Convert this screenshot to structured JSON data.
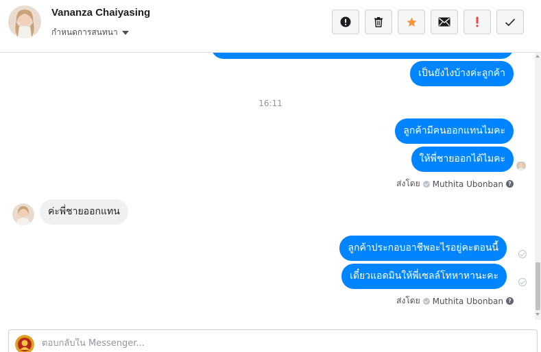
{
  "header": {
    "contact_name": "Vananza Chaiyasing",
    "assign_label": "กำหนดการสนทนา"
  },
  "toolbar": {
    "buttons": [
      {
        "name": "spam-button",
        "icon": "alert-circle-icon"
      },
      {
        "name": "delete-button",
        "icon": "trash-icon"
      },
      {
        "name": "star-button",
        "icon": "star-icon",
        "color": "#f7923b"
      },
      {
        "name": "mark-unread-button",
        "icon": "envelope-icon"
      },
      {
        "name": "follow-up-button",
        "icon": "exclamation-icon",
        "color": "#fa3e3e"
      },
      {
        "name": "mark-done-button",
        "icon": "checkmark-icon"
      }
    ]
  },
  "messages": {
    "out_1": "เป็นยังไงบ้างค่ะลูกค้า",
    "timestamp": "16:11",
    "out_2": "ลูกค้ามีคนออกแทนไมคะ",
    "out_3": "ให้พี่ชายออกได้ไมคะ",
    "sent_by_label_1": "ส่งโดย",
    "sent_by_name_1": "Muthita Ubonban",
    "in_1": "ค่ะพี่ชายออกแทน",
    "out_4": "ลูกค้าประกอบอาชีพอะไรอยู่คะตอนนี้",
    "out_5": "เดี๋ยวแอดมินให้พี่เซลล์โทหาหานะคะ",
    "sent_by_label_2": "ส่งโดย",
    "sent_by_name_2": "Muthita Ubonban",
    "help_mark": "?"
  },
  "composer": {
    "placeholder": "ตอบกลับใน Messenger..."
  },
  "colors": {
    "outgoing_bubble": "#0084ff",
    "incoming_bubble": "#f1f0f0"
  }
}
